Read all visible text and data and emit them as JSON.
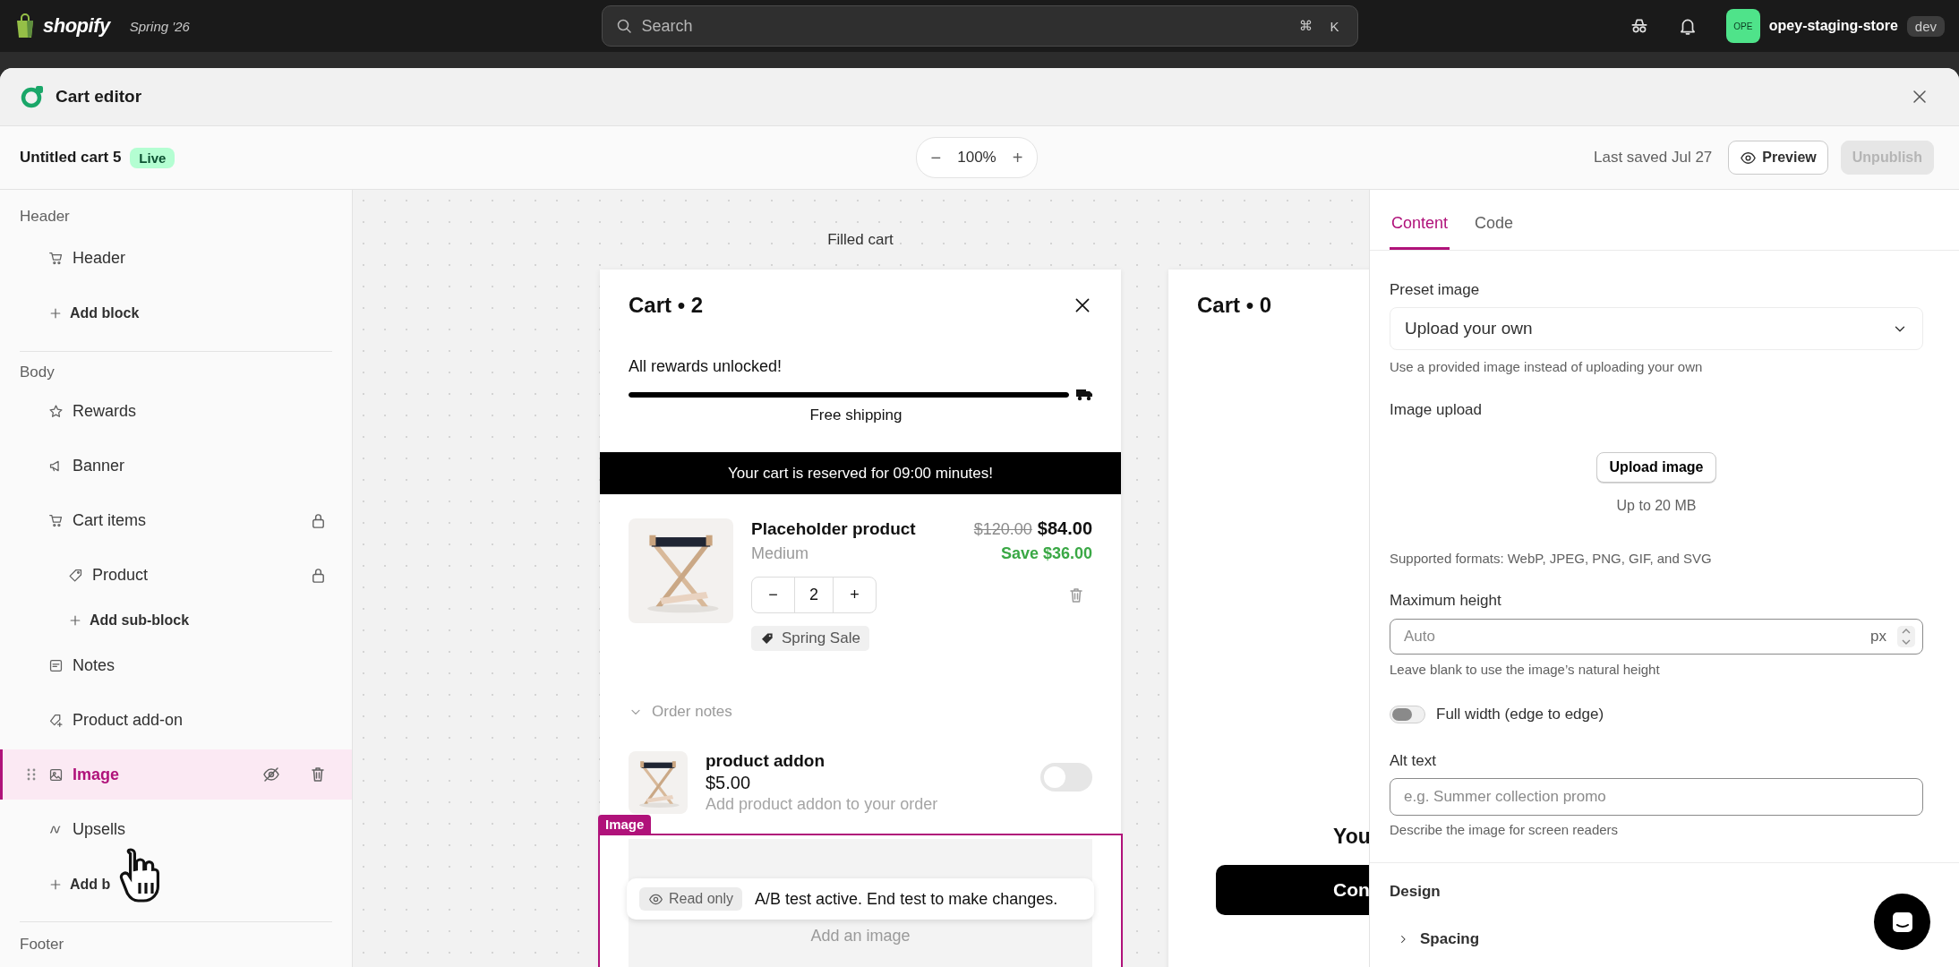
{
  "topbar": {
    "brand": "shopify",
    "edition": "Spring '26",
    "search": {
      "placeholder": "Search",
      "keys": [
        "⌘",
        "K"
      ]
    },
    "store": {
      "initials": "OPE",
      "name": "opey-staging-store",
      "badge": "dev"
    }
  },
  "editor": {
    "title": "Cart editor"
  },
  "toolbar": {
    "cart_name": "Untitled cart 5",
    "status": "Live",
    "zoom": {
      "minus": "−",
      "value": "100%",
      "plus": "+"
    },
    "last_saved": "Last saved Jul 27",
    "buttons": [
      {
        "label": "Preview",
        "kind": "icon",
        "disabled": false
      },
      {
        "label": "Unpublish",
        "kind": "plain",
        "disabled": true
      }
    ]
  },
  "sidebar": {
    "sections": [
      {
        "title": "Header",
        "items": [
          {
            "kind": "block",
            "label": "Header",
            "locked": false,
            "selected": false
          },
          {
            "kind": "add",
            "label": "Add block"
          }
        ]
      },
      {
        "title": "Body",
        "items": [
          {
            "kind": "block",
            "label": "Rewards",
            "locked": false,
            "selected": false
          },
          {
            "kind": "block",
            "label": "Banner",
            "locked": false,
            "selected": false
          },
          {
            "kind": "block",
            "label": "Cart items",
            "locked": true,
            "selected": false,
            "children": [
              {
                "kind": "block",
                "label": "Product",
                "locked": true,
                "selected": false
              },
              {
                "kind": "add",
                "label": "Add sub-block"
              }
            ]
          },
          {
            "kind": "block",
            "label": "Notes",
            "locked": false,
            "selected": false
          },
          {
            "kind": "block",
            "label": "Product add-on",
            "locked": false,
            "selected": false
          },
          {
            "kind": "block",
            "label": "Image",
            "locked": false,
            "selected": true
          },
          {
            "kind": "block",
            "label": "Upsells",
            "locked": false,
            "selected": false
          },
          {
            "kind": "add",
            "label": "Add b"
          }
        ]
      },
      {
        "title": "Footer"
      }
    ]
  },
  "canvas": {
    "label": "Filled cart",
    "carts": [
      {
        "kind": "filled",
        "title": "Cart • 2",
        "rewards": {
          "message": "All rewards unlocked!",
          "level": 1,
          "milestone": "Free shipping"
        },
        "banner": "Your cart is reserved for 09:00 minutes!",
        "items": [
          {
            "name": "Placeholder product",
            "variant": "Medium",
            "compare_price": "$120.00",
            "price": "$84.00",
            "savings": "Save $36.00",
            "minus": "−",
            "quantity": "2",
            "plus": "+",
            "discount": "Spring Sale"
          }
        ],
        "order_notes": "Order notes",
        "addon": {
          "name": "product addon",
          "price": "$5.00",
          "description": "Add product addon to your order",
          "on": false
        },
        "image_block": {
          "tag": "Image",
          "selected": true,
          "notice": {
            "badge": "Read only",
            "message": "A/B test active. End test to make changes."
          },
          "placeholder": "Add an image"
        }
      },
      {
        "kind": "empty",
        "title": "Cart • 0",
        "message": "You",
        "button": "Con"
      }
    ]
  },
  "panel": {
    "tabs": [
      {
        "label": "Content",
        "selected": true
      },
      {
        "label": "Code",
        "selected": false
      }
    ],
    "preset_image": {
      "label": "Preset image",
      "value": "Upload your own",
      "help": "Use a provided image instead of uploading your own"
    },
    "image_upload": {
      "label": "Image upload",
      "button": "Upload image",
      "limit": "Up to 20 MB",
      "formats": "Supported formats: WebP, JPEG, PNG, GIF, and SVG"
    },
    "max_height": {
      "label": "Maximum height",
      "placeholder": "Auto",
      "unit": "px",
      "help": "Leave blank to use the image’s natural height"
    },
    "full_width": {
      "label": "Full width (edge to edge)",
      "on": false
    },
    "alt_text": {
      "label": "Alt text",
      "placeholder": "e.g. Summer collection promo",
      "help": "Describe the image for screen readers"
    },
    "design": {
      "title": "Design",
      "sections": [
        {
          "label": "Spacing",
          "expanded": false
        }
      ]
    }
  }
}
